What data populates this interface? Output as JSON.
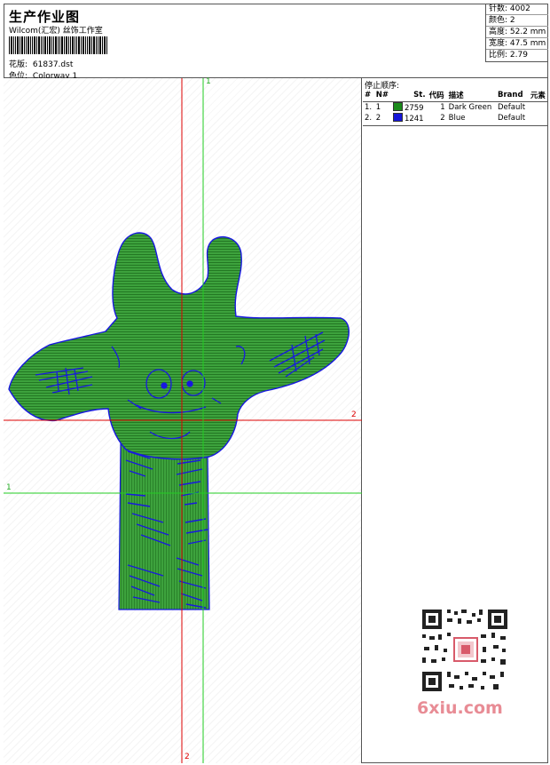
{
  "header": {
    "title": "生产作业图",
    "company": "Wilcom(汇宏) 丝饰工作室",
    "design_label": "花版:",
    "design_value": "61837.dst",
    "colorway_label": "色位:",
    "colorway_value": "Colorway 1"
  },
  "stats": {
    "stitches": "针数: 4002",
    "colors": "颜色: 2",
    "height": "高度: 52.2 mm",
    "width": "宽度: 47.5 mm",
    "scale": "比例: 2.79"
  },
  "stop_sequence": {
    "title": "停止顺序:",
    "headers": [
      "#",
      "N#",
      "St.",
      "代码",
      "描述",
      "Brand",
      "元素"
    ],
    "rows": [
      {
        "num": "1.",
        "n": "1",
        "code": "2759",
        "stop": "1",
        "desc": "Dark Green",
        "brand": "Default",
        "color": "#1a8a1a"
      },
      {
        "num": "2.",
        "n": "2",
        "code": "1241",
        "stop": "2",
        "desc": "Blue",
        "brand": "Default",
        "color": "#1515d8"
      }
    ]
  },
  "axes": {
    "green_top": "1",
    "red_right": "2",
    "green_left": "1",
    "red_bottom": "2"
  },
  "watermark": "6xiu.com",
  "colors": {
    "thread_green": "#2f9a2f",
    "thread_blue": "#1818e0",
    "axis_red": "#dd0000",
    "axis_green": "#22cc22",
    "watermark": "#e88c95"
  }
}
